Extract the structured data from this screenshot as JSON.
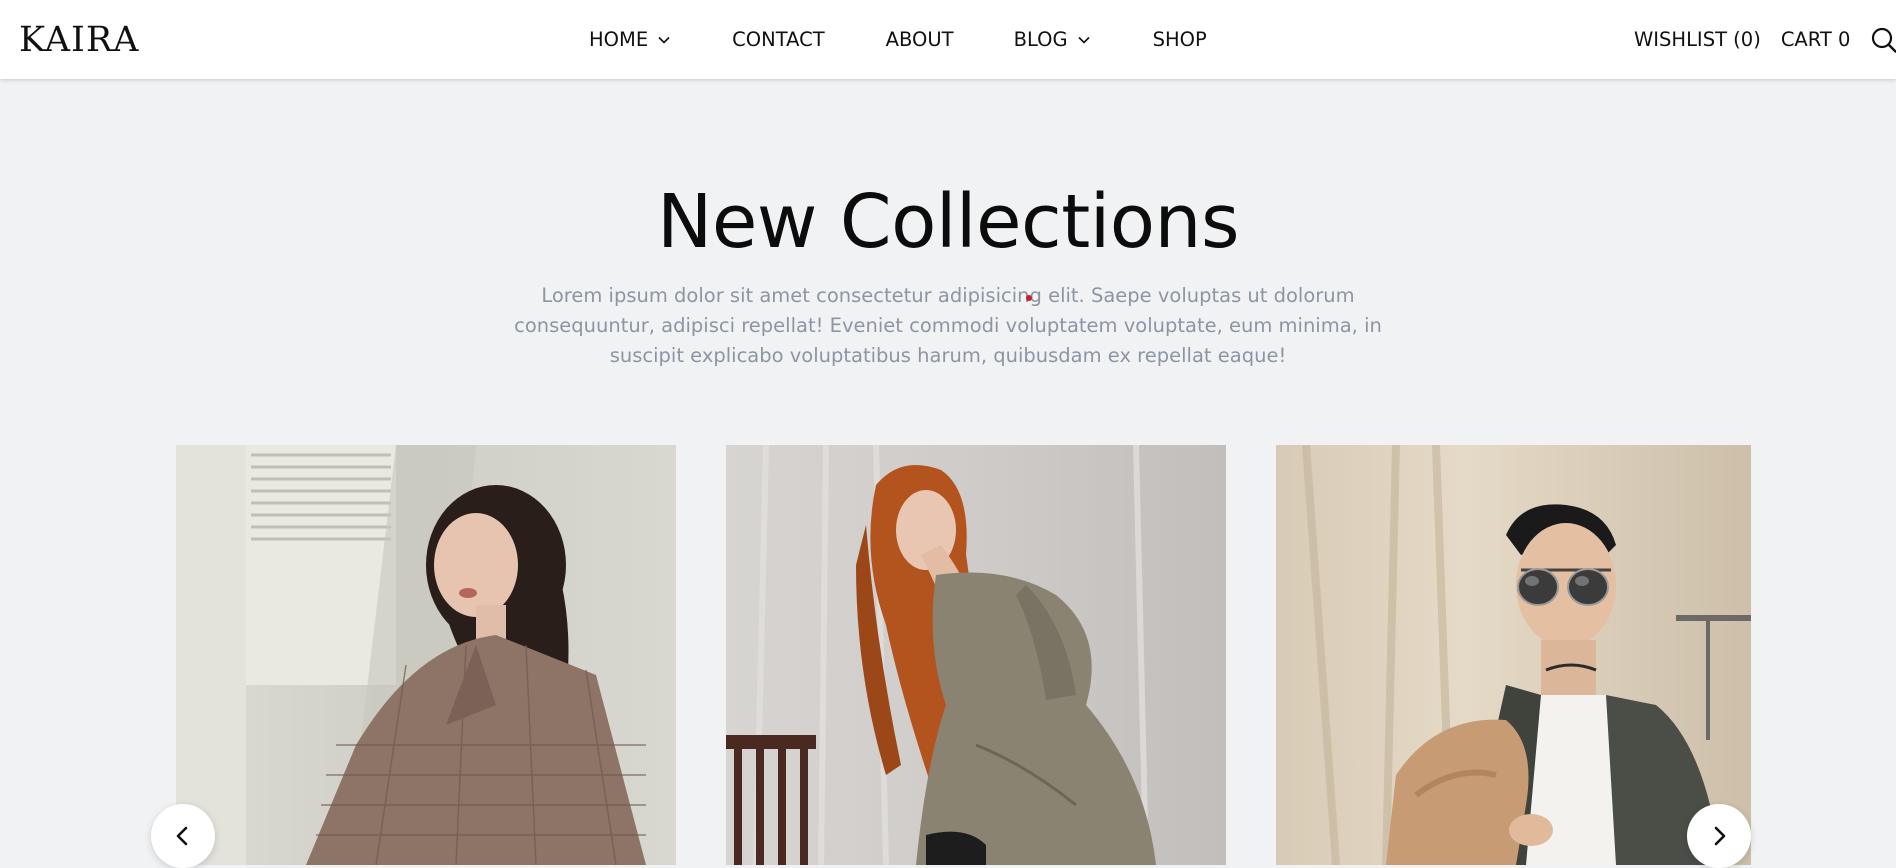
{
  "brand": {
    "logo": "KAIRA"
  },
  "nav": {
    "items": [
      {
        "label": "HOME",
        "has_dropdown": true
      },
      {
        "label": "CONTACT",
        "has_dropdown": false
      },
      {
        "label": "ABOUT",
        "has_dropdown": false
      },
      {
        "label": "BLOG",
        "has_dropdown": true
      },
      {
        "label": "SHOP",
        "has_dropdown": false
      }
    ]
  },
  "tools": {
    "wishlist": "WISHLIST (0)",
    "cart": "CART 0",
    "search_icon": "search-icon"
  },
  "section": {
    "title": "New Collections",
    "description": "Lorem ipsum dolor sit amet consectetur adipisicing elit. Saepe voluptas ut dolorum consequuntur, adipisci repellat! Eveniet commodi voluptatem voluptate, eum minima, in suscipit explicabo voluptatibus harum, quibusdam ex repellat eaque!"
  },
  "carousel": {
    "prev_icon": "chevron-left-icon",
    "next_icon": "chevron-right-icon",
    "products": [
      {
        "image": "woman-in-plaid-blazer-photo"
      },
      {
        "image": "woman-with-red-curly-hair-on-chair-photo"
      },
      {
        "image": "man-in-sunglasses-fur-coat-photo"
      }
    ]
  },
  "colors": {
    "header_bg": "#ffffff",
    "page_bg": "#f1f2f4",
    "text": "#111111",
    "muted_text": "#8d95a3"
  }
}
